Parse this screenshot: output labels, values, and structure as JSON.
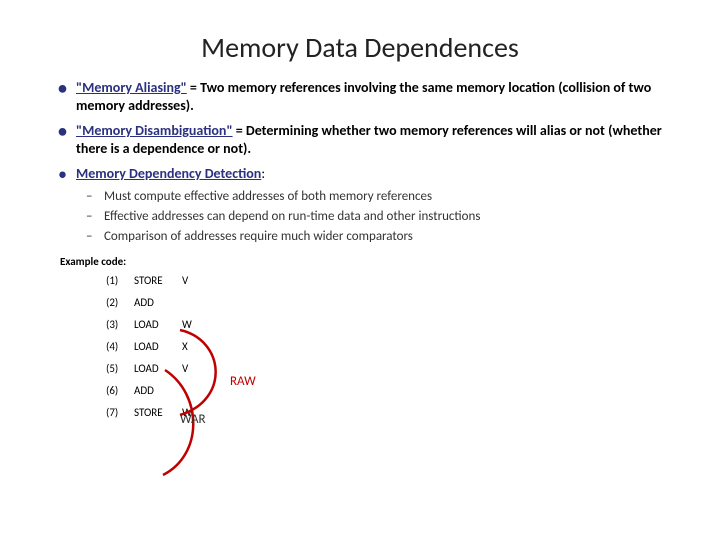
{
  "title": "Memory Data Dependences",
  "bullets": {
    "b1_term": "\"Memory Aliasing\"",
    "b1_rest": " = Two memory references involving the same memory location (collision of two memory addresses).",
    "b2_term": "\"Memory Disambiguation\"",
    "b2_rest": " = Determining whether two memory references will alias or not (whether there is a dependence or not).",
    "b3_term": "Memory Dependency Detection",
    "b3_colon": ":",
    "sub1": "Must compute effective addresses of both memory references",
    "sub2": "Effective addresses can depend on run-time data and other instructions",
    "sub3": "Comparison of addresses require much wider comparators"
  },
  "example_label": "Example code:",
  "code": [
    {
      "n": "(1)",
      "op": "STORE",
      "arg": "V"
    },
    {
      "n": "(2)",
      "op": "ADD",
      "arg": ""
    },
    {
      "n": "(3)",
      "op": "LOAD",
      "arg": "W"
    },
    {
      "n": "(4)",
      "op": "LOAD",
      "arg": "X"
    },
    {
      "n": "(5)",
      "op": "LOAD",
      "arg": "V"
    },
    {
      "n": "(6)",
      "op": "ADD",
      "arg": ""
    },
    {
      "n": "(7)",
      "op": "STORE",
      "arg": "W"
    }
  ],
  "annotations": {
    "raw": "RAW",
    "war": "WAR"
  }
}
